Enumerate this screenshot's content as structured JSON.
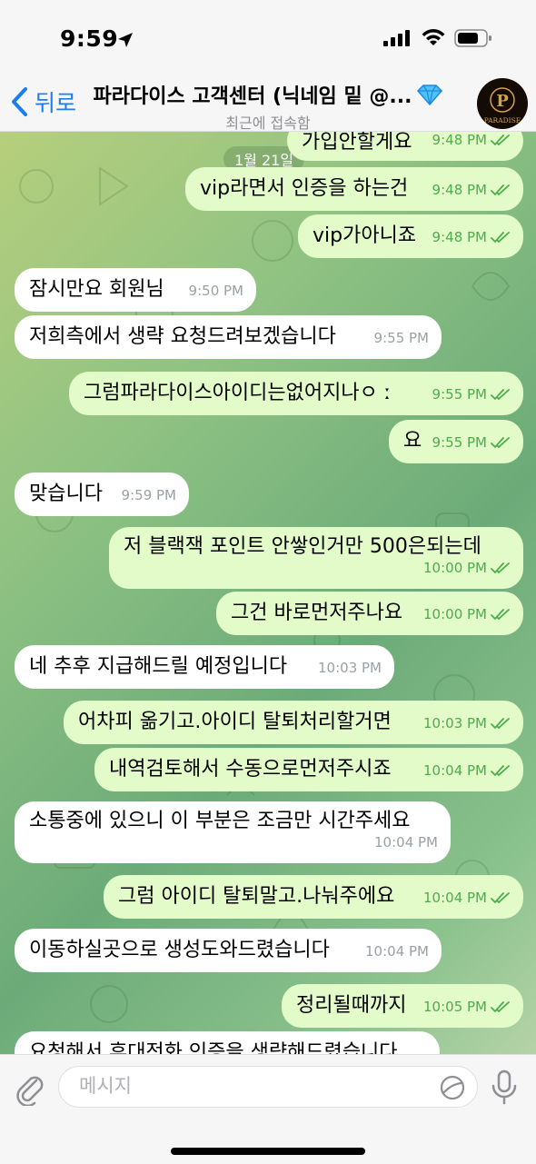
{
  "status_bar": {
    "time": "9:59"
  },
  "header": {
    "back_label": "뒤로",
    "title": "파라다이스 고객센터 (닉네임 밑 @...",
    "subtitle": "최근에 접속함",
    "avatar_text": "PARADISE"
  },
  "chat": {
    "date_chip": "1월 21일",
    "messages": [
      {
        "dir": "out",
        "text": "가입안할게요",
        "time": "9:48 PM",
        "read": true
      },
      {
        "dir": "out",
        "text": "vip라면서 인증을 하는건",
        "time": "9:48 PM",
        "read": true
      },
      {
        "dir": "out",
        "text": "vip가아니죠",
        "time": "9:48 PM",
        "read": true
      },
      {
        "dir": "in",
        "text": "잠시만요 회원님",
        "time": "9:50 PM"
      },
      {
        "dir": "in",
        "text": "저희측에서 생략 요청드려보겠습니다",
        "time": "9:55 PM"
      },
      {
        "dir": "out",
        "text": "그럼파라다이스아이디는없어지나ㅇ ː",
        "time": "9:55 PM",
        "read": true
      },
      {
        "dir": "out",
        "text": "요",
        "time": "9:55 PM",
        "read": true
      },
      {
        "dir": "in",
        "text": "맞습니다",
        "time": "9:59 PM"
      },
      {
        "dir": "out",
        "text": "저 블랙잭 포인트 안쌓인거만 500은되는데",
        "time": "10:00 PM",
        "read": true
      },
      {
        "dir": "out",
        "text": "그건 바로먼저주나요",
        "time": "10:00 PM",
        "read": true
      },
      {
        "dir": "in",
        "text": "네 추후 지급해드릴 예정입니다",
        "time": "10:03 PM"
      },
      {
        "dir": "out",
        "text": "어차피 옮기고.아이디 탈퇴처리할거면",
        "time": "10:03 PM",
        "read": true
      },
      {
        "dir": "out",
        "text": "내역검토해서 수동으로먼저주시죠",
        "time": "10:04 PM",
        "read": true
      },
      {
        "dir": "in",
        "text": "소통중에 있으니 이 부분은 조금만 시간주세요",
        "time": "10:04 PM"
      },
      {
        "dir": "out",
        "text": "그럼 아이디 탈퇴말고.나눠주에요",
        "time": "10:04 PM",
        "read": true
      },
      {
        "dir": "in",
        "text": "이동하실곳으로 생성도와드렸습니다",
        "time": "10:04 PM"
      },
      {
        "dir": "out",
        "text": "정리될때까지",
        "time": "10:05 PM",
        "read": true
      },
      {
        "dir": "in",
        "text": "요청해서 휴대전화 인증을 생략해드렸습니다",
        "time": ""
      }
    ]
  },
  "input": {
    "placeholder": "메시지"
  },
  "colors": {
    "accent": "#1a7ef2",
    "outgoing_bubble": "#e3fbc8",
    "incoming_bubble": "#ffffff",
    "read_check": "#4dac4e"
  }
}
